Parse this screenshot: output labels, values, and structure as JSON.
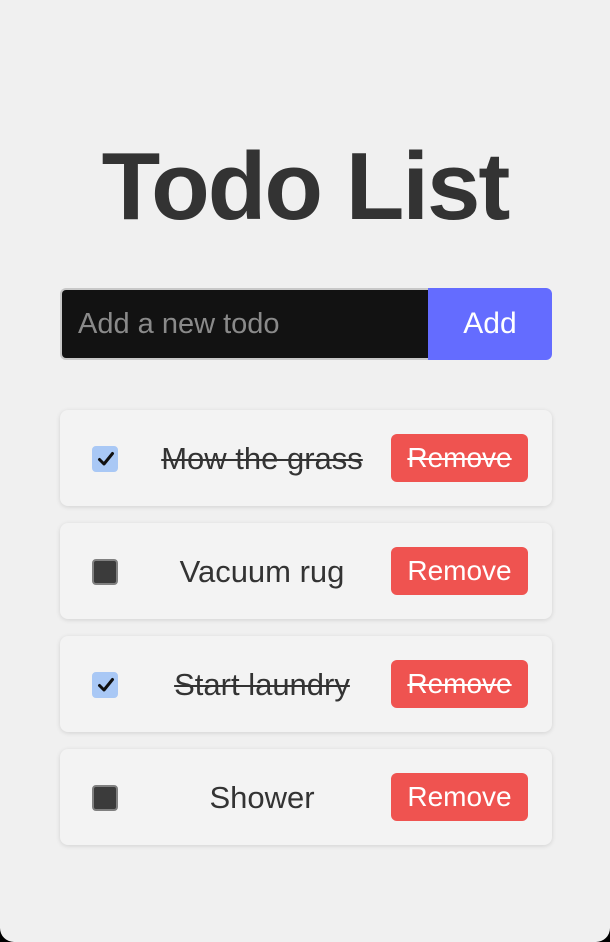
{
  "header": {
    "title": "Todo List"
  },
  "add_form": {
    "input_value": "",
    "input_placeholder": "Add a new todo",
    "add_label": "Add"
  },
  "todos": [
    {
      "text": "Mow the grass",
      "completed": true,
      "remove_label": "Remove"
    },
    {
      "text": "Vacuum rug",
      "completed": false,
      "remove_label": "Remove"
    },
    {
      "text": "Start laundry",
      "completed": true,
      "remove_label": "Remove"
    },
    {
      "text": "Shower",
      "completed": false,
      "remove_label": "Remove"
    }
  ],
  "icons": {
    "checkmark": "checkmark-icon"
  },
  "colors": {
    "background": "#f0f0f0",
    "title": "#333333",
    "input_background": "#121212",
    "add_button": "#646cff",
    "remove_button": "#ef5350",
    "checkbox_checked": "#a9c8f5",
    "checkbox_unchecked": "#3b3b3b"
  }
}
